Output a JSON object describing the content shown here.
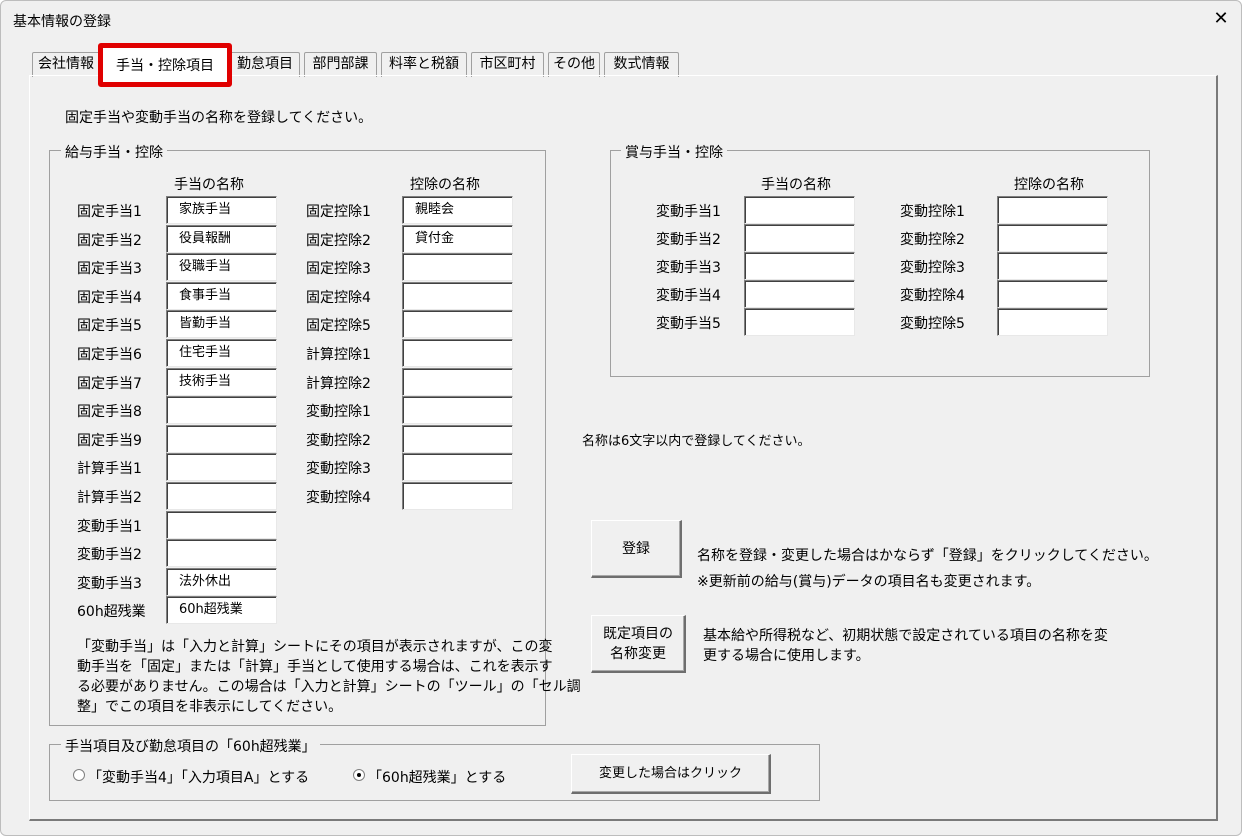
{
  "window": {
    "title": "基本情報の登録",
    "close_glyph": "✕"
  },
  "tabs": [
    "会社情報",
    "手当・控除項目",
    "勤怠項目",
    "部門部課",
    "料率と税額",
    "市区町村",
    "その他",
    "数式情報"
  ],
  "instruction": "固定手当や変動手当の名称を登録してください。",
  "salary": {
    "legend": "給与手当・控除",
    "allowance_header": "手当の名称",
    "deduction_header": "控除の名称",
    "allowances": [
      {
        "label": "固定手当1",
        "value": "家族手当"
      },
      {
        "label": "固定手当2",
        "value": "役員報酬"
      },
      {
        "label": "固定手当3",
        "value": "役職手当"
      },
      {
        "label": "固定手当4",
        "value": "食事手当"
      },
      {
        "label": "固定手当5",
        "value": "皆勤手当"
      },
      {
        "label": "固定手当6",
        "value": "住宅手当"
      },
      {
        "label": "固定手当7",
        "value": "技術手当"
      },
      {
        "label": "固定手当8",
        "value": ""
      },
      {
        "label": "固定手当9",
        "value": ""
      },
      {
        "label": "計算手当1",
        "value": ""
      },
      {
        "label": "計算手当2",
        "value": ""
      },
      {
        "label": "変動手当1",
        "value": ""
      },
      {
        "label": "変動手当2",
        "value": ""
      },
      {
        "label": "変動手当3",
        "value": "法外休出"
      },
      {
        "label": "60h超残業",
        "value": "60h超残業"
      }
    ],
    "deductions": [
      {
        "label": "固定控除1",
        "value": "親睦会"
      },
      {
        "label": "固定控除2",
        "value": "貸付金"
      },
      {
        "label": "固定控除3",
        "value": ""
      },
      {
        "label": "固定控除4",
        "value": ""
      },
      {
        "label": "固定控除5",
        "value": ""
      },
      {
        "label": "計算控除1",
        "value": ""
      },
      {
        "label": "計算控除2",
        "value": ""
      },
      {
        "label": "変動控除1",
        "value": ""
      },
      {
        "label": "変動控除2",
        "value": ""
      },
      {
        "label": "変動控除3",
        "value": ""
      },
      {
        "label": "変動控除4",
        "value": ""
      }
    ],
    "note_lines": [
      "「変動手当」は「入力と計算」シートにその項目が表示されますが、この変",
      "動手当を「固定」または「計算」手当として使用する場合は、これを表示す",
      "る必要がありません。この場合は「入力と計算」シートの「ツール」の「セル調",
      "整」でこの項目を非表示にしてください。"
    ]
  },
  "bonus": {
    "legend": "賞与手当・控除",
    "allowance_header": "手当の名称",
    "deduction_header": "控除の名称",
    "allowances": [
      {
        "label": "変動手当1",
        "value": ""
      },
      {
        "label": "変動手当2",
        "value": ""
      },
      {
        "label": "変動手当3",
        "value": ""
      },
      {
        "label": "変動手当4",
        "value": ""
      },
      {
        "label": "変動手当5",
        "value": ""
      }
    ],
    "deductions": [
      {
        "label": "変動控除1",
        "value": ""
      },
      {
        "label": "変動控除2",
        "value": ""
      },
      {
        "label": "変動控除3",
        "value": ""
      },
      {
        "label": "変動控除4",
        "value": ""
      },
      {
        "label": "変動控除5",
        "value": ""
      }
    ]
  },
  "name_limit_note": "名称は6文字以内で登録してください。",
  "register": {
    "button_label": "登録",
    "note_line1": "名称を登録・変更した場合はかならず「登録」をクリックしてください。",
    "note_line2": "※更新前の給与(賞与)データの項目名も変更されます。"
  },
  "rename_default": {
    "button_line1": "既定項目の",
    "button_line2": "名称変更",
    "note_line1": "基本給や所得税など、初期状態で設定されている項目の名称を変",
    "note_line2": "更する場合に使用します。"
  },
  "overtime": {
    "legend": "手当項目及び勤怠項目の「60h超残業」",
    "option1": "「変動手当4」「入力項目A」とする",
    "option2": "「60h超残業」とする",
    "selected": 2,
    "apply_button": "変更した場合はクリック"
  }
}
